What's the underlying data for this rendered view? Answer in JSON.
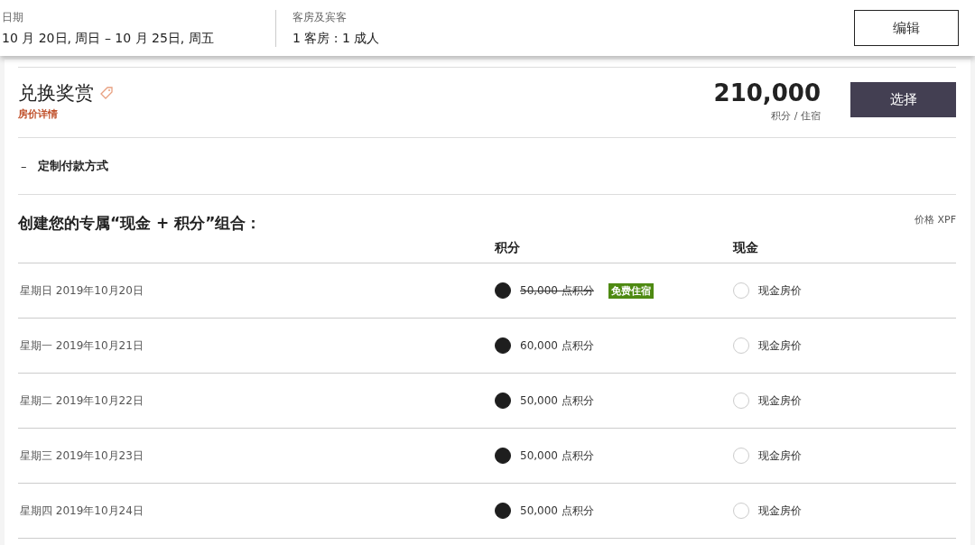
{
  "search_summary": {
    "dates": {
      "label": "日期",
      "value": "10 月 20日, 周日 – 10 月 25日, 周五"
    },
    "rooms": {
      "label": "客房及宾客",
      "value": "1 客房 : 1 成人"
    },
    "edit_button": "编辑"
  },
  "rate": {
    "title": "兑换奖赏",
    "details_link": "房价详情",
    "price": "210,000",
    "price_unit": "积分 / 住宿",
    "select_button": "选择"
  },
  "payment_toggle": {
    "symbol": "–",
    "label": "定制付款方式",
    "expanded": true
  },
  "combo": {
    "title": "创建您的专属“现金 + 积分”组合：",
    "currency_note": "价格 XPF",
    "columns": [
      "积分",
      "现金"
    ],
    "rows": [
      {
        "date": "星期日 2019年10月20日",
        "points": "50,000 点积分",
        "struck": true,
        "badge": "免费住宿",
        "points_selected": true,
        "cash": "现金房价",
        "cash_selected": false
      },
      {
        "date": "星期一 2019年10月21日",
        "points": "60,000 点积分",
        "struck": false,
        "points_selected": true,
        "cash": "现金房价",
        "cash_selected": false
      },
      {
        "date": "星期二 2019年10月22日",
        "points": "50,000 点积分",
        "struck": false,
        "points_selected": true,
        "cash": "现金房价",
        "cash_selected": false
      },
      {
        "date": "星期三 2019年10月23日",
        "points": "50,000 点积分",
        "struck": false,
        "points_selected": true,
        "cash": "现金房价",
        "cash_selected": false
      },
      {
        "date": "星期四 2019年10月24日",
        "points": "50,000 点积分",
        "struck": false,
        "points_selected": true,
        "cash": "现金房价",
        "cash_selected": false
      }
    ]
  }
}
